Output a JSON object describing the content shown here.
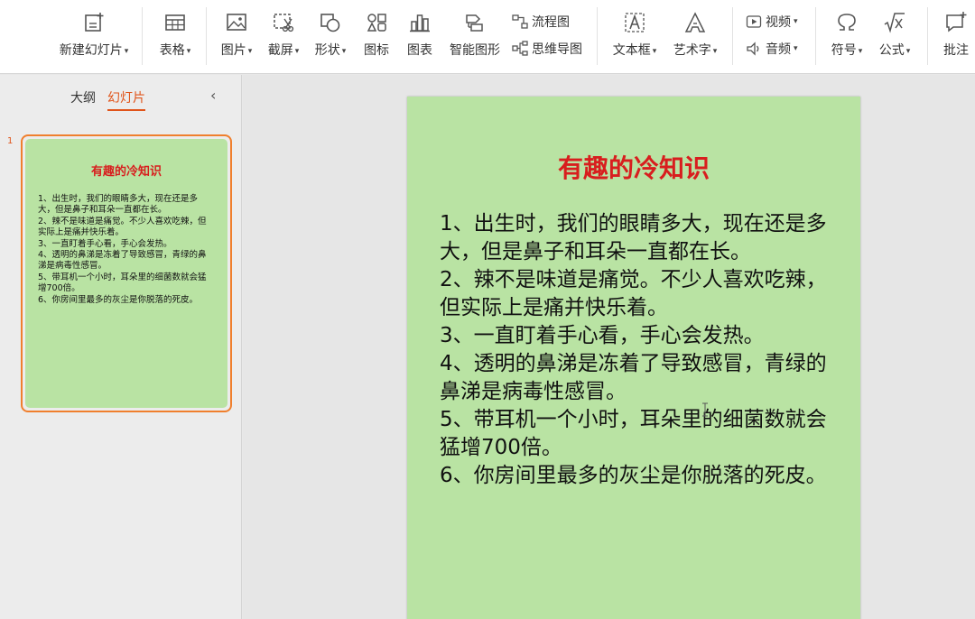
{
  "ribbon": {
    "new_slide": "新建幻灯片",
    "table": "表格",
    "picture": "图片",
    "screenshot": "截屏",
    "shape": "形状",
    "icon": "图标",
    "chart": "图表",
    "smart_graphic": "智能图形",
    "flowchart": "流程图",
    "mindmap": "思维导图",
    "textbox": "文本框",
    "wordart": "艺术字",
    "video": "视频",
    "audio": "音频",
    "symbol": "符号",
    "formula": "公式",
    "comment": "批注",
    "dropdown_arrow": "▾"
  },
  "left_panel": {
    "tab_outline": "大纲",
    "tab_slides": "幻灯片",
    "collapse": "‹",
    "slide_number": "1"
  },
  "slide": {
    "title": "有趣的冷知识",
    "body": "1、出生时，我们的眼睛多大，现在还是多大，但是鼻子和耳朵一直都在长。\n2、辣不是味道是痛觉。不少人喜欢吃辣，但实际上是痛并快乐着。\n3、一直盯着手心看，手心会发热。\n4、透明的鼻涕是冻着了导致感冒，青绿的鼻涕是病毒性感冒。\n5、带耳机一个小时，耳朵里的细菌数就会猛增700倍。\n6、你房间里最多的灰尘是你脱落的死皮。"
  },
  "colors": {
    "slide_bg": "#b9e3a3",
    "title_red": "#d81e1e",
    "accent_orange": "#e0541a",
    "thumb_border": "#f07f2d"
  }
}
